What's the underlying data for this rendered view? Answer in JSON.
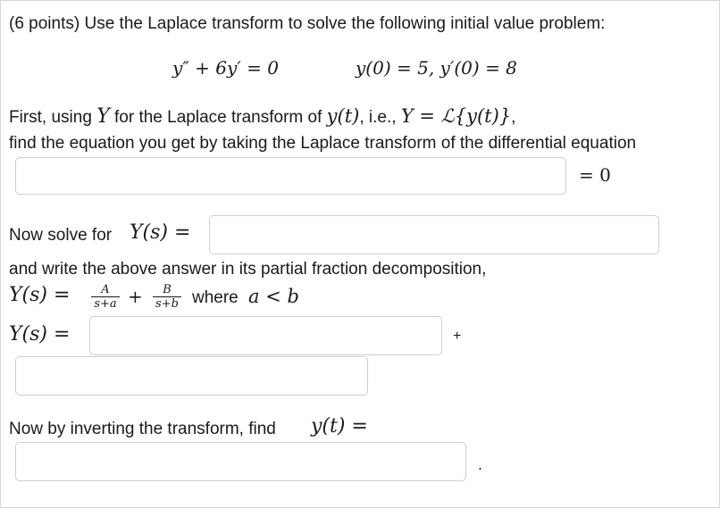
{
  "problem": {
    "intro": "(6 points) Use the Laplace transform to solve the following initial value problem:",
    "ode": "y″ + 6y′ = 0",
    "initial_conditions": "y(0) = 5,  y′(0) = 8"
  },
  "step1": {
    "line1_prefix": "First, using ",
    "line1_Y": "Y",
    "line1_mid": " for the Laplace transform of ",
    "line1_yt": "y(t)",
    "line1_ie": ", i.e., ",
    "line1_def": "Y = ℒ{y(t)}",
    "line1_end": ",",
    "line2": "find the equation you get by taking the Laplace transform of the differential equation",
    "equals_zero": "= 0",
    "input_value": ""
  },
  "step2": {
    "prefix": "Now solve for ",
    "Ys": "Y(s) =",
    "input_value": ""
  },
  "step3": {
    "line1": "and write the above answer in its partial fraction decomposition,",
    "Ys_eq": "Y(s) =",
    "frac_A_num": "A",
    "frac_A_den": "s+a",
    "plus": "+",
    "frac_B_num": "B",
    "frac_B_den": "s+b",
    "where_text": "where",
    "condition": "a < b",
    "Ys_answer_label": "Y(s) =",
    "plus_after_box": "+",
    "input1_value": "",
    "input2_value": ""
  },
  "step4": {
    "prefix": "Now by inverting the transform, find ",
    "yt": "y(t) =",
    "period": ".",
    "input_value": ""
  }
}
